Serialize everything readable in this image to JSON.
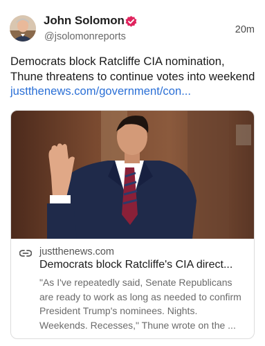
{
  "author": {
    "name": "John Solomon",
    "handle": "@jsolomonreports",
    "verified": true,
    "avatar_icon": "person-portrait-icon"
  },
  "timestamp": "20m",
  "post": {
    "text": "Democrats block Ratcliffe CIA nomination, Thune threatens to continue votes into weekend ",
    "link_text": "justthenews.com/government/con..."
  },
  "card": {
    "image_icon": "man-taking-oath-photo",
    "domain": "justthenews.com",
    "title": "Democrats block Ratcliffe's CIA direct...",
    "description": "\"As I've repeatedly said, Senate Republicans are ready to work as long as needed to confirm President Trump's nominees. Nights. Weekends. Recesses,\" Thune wrote on the ..."
  },
  "colors": {
    "link": "#2a6fd6",
    "verified_badge": "#e0245e"
  }
}
